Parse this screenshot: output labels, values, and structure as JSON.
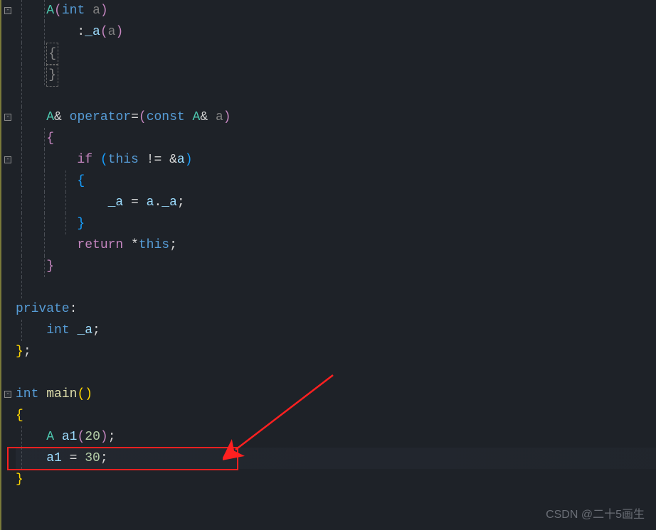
{
  "code": {
    "l1": {
      "pad": "    ",
      "name": "A",
      "lp": "(",
      "kw": "int",
      "sp": " ",
      "param": "a",
      "rp": ")"
    },
    "l2": {
      "pad": "        ",
      "init": ":",
      "field": "_a",
      "lp": "(",
      "arg": "a",
      "rp": ")"
    },
    "l3": {
      "pad": "    ",
      "brace": "{"
    },
    "l4": {
      "pad": "    ",
      "brace": "}"
    },
    "l6": {
      "pad": "    ",
      "type": "A",
      "amp": "& ",
      "op_kw": "operator",
      "op": "=",
      "lp": "(",
      "kw_const": "const",
      "sp1": " ",
      "type2": "A",
      "amp2": "&",
      "sp2": " ",
      "param": "a",
      "rp": ")"
    },
    "l7": {
      "pad": "    ",
      "brace": "{"
    },
    "l8": {
      "pad": "        ",
      "kw_if": "if",
      "sp": " ",
      "lp": "(",
      "kw_this": "this",
      "neq": " != ",
      "amp": "&",
      "var": "a",
      "rp": ")"
    },
    "l9": {
      "pad": "        ",
      "brace": "{"
    },
    "l10": {
      "pad": "            ",
      "field": "_a",
      "eq": " = ",
      "obj": "a",
      "dot": ".",
      "field2": "_a",
      "semi": ";"
    },
    "l11": {
      "pad": "        ",
      "brace": "}"
    },
    "l12": {
      "pad": "        ",
      "kw_ret": "return",
      "sp": " ",
      "star": "*",
      "kw_this": "this",
      "semi": ";"
    },
    "l13": {
      "pad": "    ",
      "brace": "}"
    },
    "l15": {
      "kw": "private",
      "colon": ":"
    },
    "l16": {
      "pad": "    ",
      "kw": "int",
      "sp": " ",
      "var": "_a",
      "semi": ";"
    },
    "l17": {
      "brace": "}",
      "semi": ";"
    },
    "l19": {
      "kw": "int",
      "sp": " ",
      "fn": "main",
      "lp": "(",
      "rp": ")"
    },
    "l20": {
      "brace": "{"
    },
    "l21": {
      "pad": "    ",
      "type": "A",
      "sp": " ",
      "var": "a1",
      "lp": "(",
      "num": "20",
      "rp": ")",
      "semi": ";"
    },
    "l22": {
      "pad": "    ",
      "var": "a1",
      "eq": " = ",
      "num": "30",
      "semi": ";"
    },
    "l23": {
      "brace": "}"
    }
  },
  "watermark": "CSDN @二十5画生"
}
